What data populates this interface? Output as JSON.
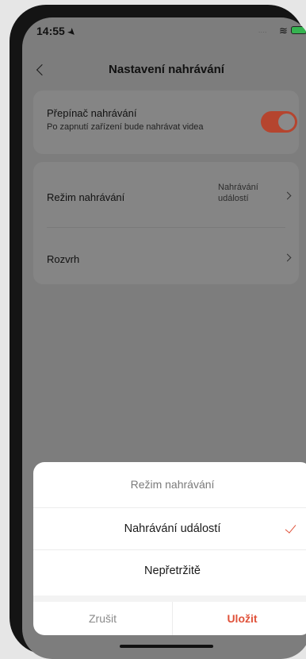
{
  "status_bar": {
    "time": "14:55",
    "signal": "....",
    "wifi_icon": "wifi-icon",
    "battery_icon": "battery-charging-icon"
  },
  "nav": {
    "title": "Nastavení nahrávání",
    "back_icon": "chevron-left-icon"
  },
  "recording_switch": {
    "label": "Přepínač nahrávání",
    "description": "Po zapnutí zařízení bude nahrávat videa",
    "enabled": true
  },
  "settings": {
    "mode": {
      "label": "Režim nahrávání",
      "value_line1": "Nahrávání",
      "value_line2": "událostí"
    },
    "schedule": {
      "label": "Rozvrh"
    }
  },
  "sheet": {
    "title": "Režim nahrávání",
    "options": [
      {
        "label": "Nahrávání událostí",
        "selected": true
      },
      {
        "label": "Nepřetržitě",
        "selected": false
      }
    ],
    "cancel_label": "Zrušit",
    "save_label": "Uložit"
  },
  "colors": {
    "accent": "#e0523a",
    "overlay": "#7d7d7d",
    "sheet": "#ffffff"
  }
}
